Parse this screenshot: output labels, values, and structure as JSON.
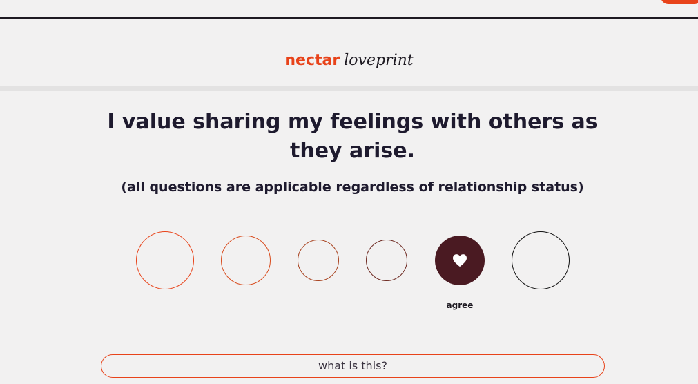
{
  "header": {
    "brand": "nectar",
    "product": "loveprint"
  },
  "question": {
    "text": "I value sharing my feelings with others as they arise.",
    "subtitle": "(all questions are applicable regardless of relationship status)"
  },
  "answers": {
    "count": 6,
    "selected_index": 4,
    "selected_label": "agree",
    "selected_icon": "heart-icon"
  },
  "help": {
    "label": "what is this?"
  },
  "colors": {
    "brand": "#e8431a",
    "selected": "#4a1a22",
    "text": "#1e1a2e",
    "background": "#f2f1f1"
  }
}
